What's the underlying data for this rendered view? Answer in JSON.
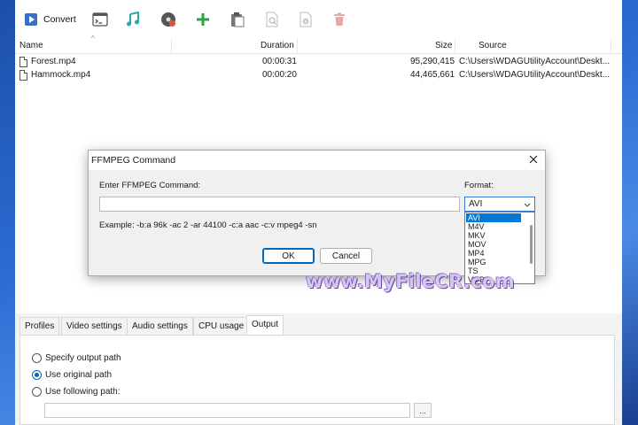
{
  "toolbar": {
    "convert_label": "Convert",
    "icons": [
      "convert-icon",
      "terminal-icon",
      "music-icon",
      "disc-burn-icon",
      "add-icon",
      "clipboard-icon",
      "file-search-icon",
      "file-info-icon",
      "delete-icon"
    ],
    "colors": {
      "add": "#2ea043",
      "music": "#2aa9b5",
      "delete": "#e9a8a8"
    }
  },
  "file_list": {
    "columns": {
      "name": "Name",
      "duration": "Duration",
      "size": "Size",
      "source": "Source"
    },
    "rows": [
      {
        "name": "Forest.mp4",
        "duration": "00:00:31",
        "size": "95,290,415",
        "source": "C:\\Users\\WDAGUtilityAccount\\Deskt..."
      },
      {
        "name": "Hammock.mp4",
        "duration": "00:00:20",
        "size": "44,465,661",
        "source": "C:\\Users\\WDAGUtilityAccount\\Deskt..."
      }
    ]
  },
  "dialog": {
    "title": "FFMPEG Command",
    "command_label": "Enter FFMPEG Command:",
    "command_value": "",
    "format_label": "Format:",
    "format_selected": "AVI",
    "format_options": [
      "AVI",
      "M4V",
      "MKV",
      "MOV",
      "MP4",
      "MPG",
      "TS",
      "VOB"
    ],
    "example": "Example: -b:a 96k -ac 2 -ar 44100 -c:a aac -c:v mpeg4 -sn",
    "ok_label": "OK",
    "cancel_label": "Cancel"
  },
  "watermark": "www.MyFileCR.com",
  "bottom_panel": {
    "tabs": [
      "Profiles",
      "Video settings",
      "Audio settings",
      "CPU usage",
      "Output"
    ],
    "active_tab": "Output",
    "options": [
      "Specify output path",
      "Use original path",
      "Use following path:"
    ],
    "selected_option": "Use original path",
    "path_value": "",
    "browse_label": "..."
  }
}
